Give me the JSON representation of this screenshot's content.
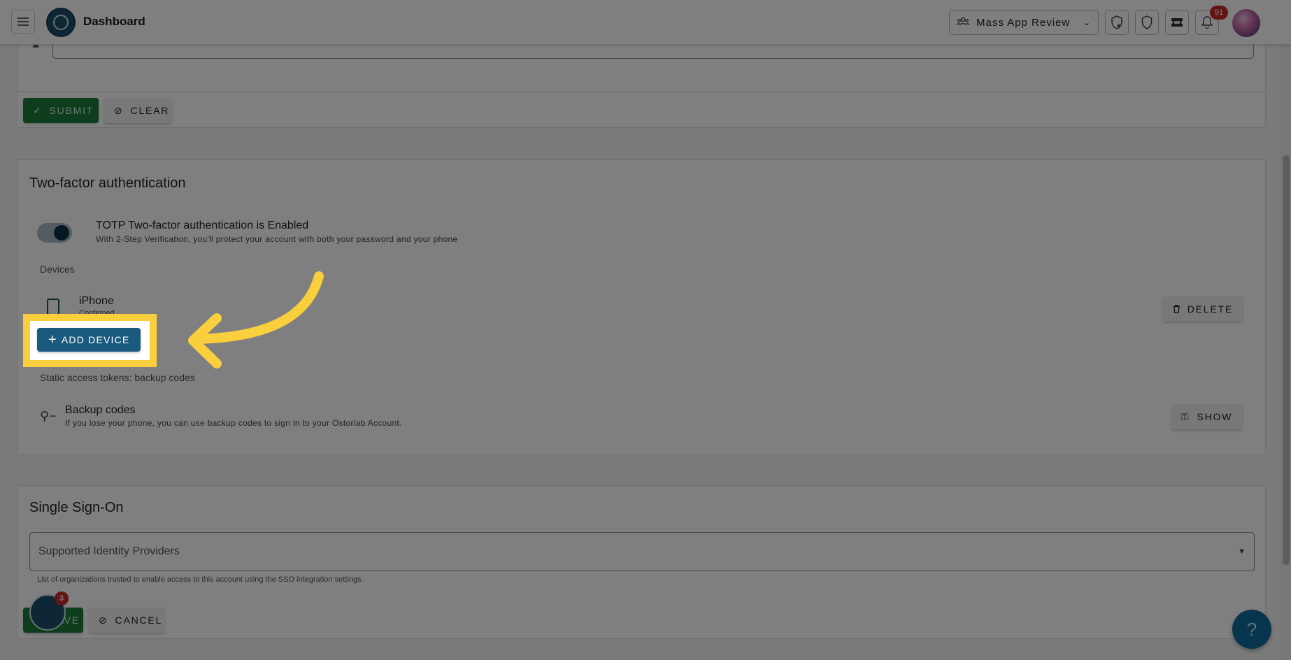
{
  "header": {
    "title": "Dashboard",
    "org_selector": "Mass App Review",
    "notification_count": "91",
    "icons": [
      "menu-icon",
      "add-shield-icon",
      "shield-icon",
      "ticket-icon",
      "bell-icon"
    ]
  },
  "form_actions": {
    "submit_label": "Submit",
    "clear_label": "Clear"
  },
  "two_factor": {
    "title": "Two-factor authentication",
    "toggle_enabled": true,
    "totp_title": "TOTP Two-factor authentication is Enabled",
    "totp_subtitle": "With 2-Step Verification, you'll protect your account with both your password and your phone",
    "devices_label": "Devices",
    "devices": [
      {
        "name": "iPhone",
        "status": "Confirmed",
        "delete_label": "Delete"
      }
    ],
    "add_device_label": "Add Device",
    "static_tokens_label": "Static access tokens: backup codes",
    "backup_title": "Backup codes",
    "backup_subtitle": "If you lose your phone, you can use backup codes to sign in to your Ostorlab Account.",
    "show_label": "Show"
  },
  "sso": {
    "title": "Single Sign-On",
    "select_placeholder": "Supported Identity Providers",
    "helper_text": "List of organizations trusted to enable access to this account using the SSO integration settings.",
    "save_label": "Save",
    "cancel_label": "Cancel"
  },
  "floating": {
    "chat_badge": "3",
    "help_label": "?"
  },
  "colors": {
    "highlight": "#f9cf3d",
    "primary": "#1a5a7e",
    "success": "#1c7a3a",
    "danger": "#c62828"
  }
}
